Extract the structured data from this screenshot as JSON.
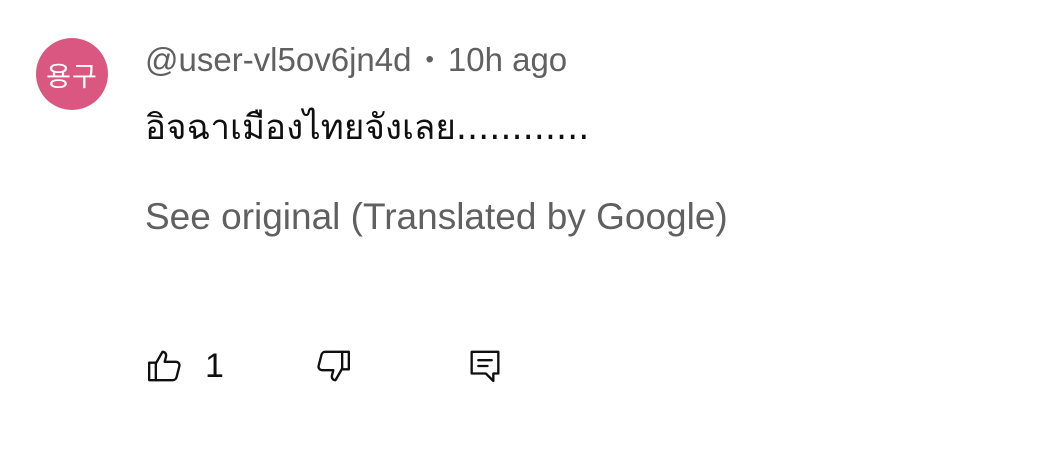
{
  "comment": {
    "avatar_text": "용구",
    "avatar_color": "#d95781",
    "author": "@user-vl5ov6jn4d",
    "separator": "•",
    "time": "10h ago",
    "text": "อิจฉาเมืองไทยจังเลย............",
    "see_original": "See original (Translated by Google)",
    "actions": {
      "like_count": "1",
      "like_icon": "thumbs-up-icon",
      "dislike_icon": "thumbs-down-icon",
      "reply_icon": "reply-comment-icon"
    }
  }
}
